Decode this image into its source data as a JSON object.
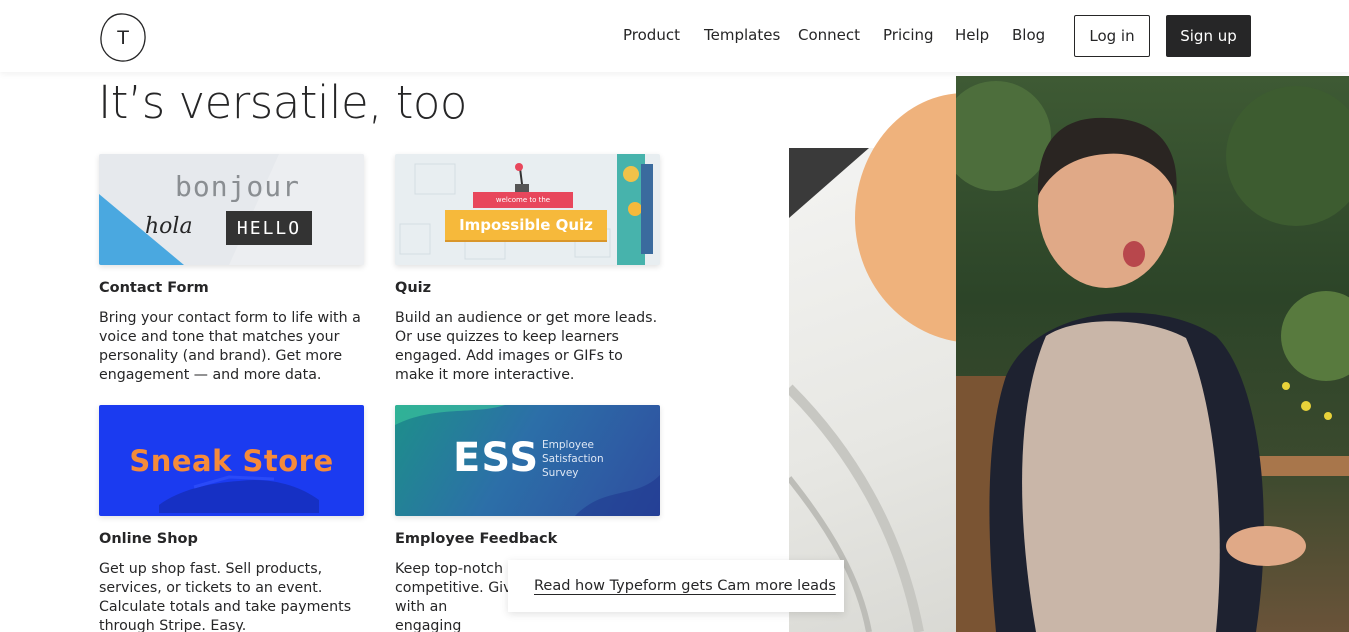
{
  "header": {
    "logo_letter": "T",
    "nav": [
      "Product",
      "Templates",
      "Connect",
      "Pricing",
      "Help",
      "Blog"
    ],
    "login_label": "Log in",
    "signup_label": "Sign up"
  },
  "main": {
    "heading": "It’s versatile, too",
    "cards": [
      {
        "title": "Contact Form",
        "description": "Bring your contact form to life with a voice and tone that matches your personality (and brand). Get more engagement — and more data.",
        "image_words": [
          "bonjour",
          "hola",
          "HELLO"
        ]
      },
      {
        "title": "Quiz",
        "description": "Build an audience or get more leads. Or use quizzes to keep learners engaged. Add images or GIFs to make it more interactive.",
        "image_words": [
          "welcome to the",
          "Impossible Quiz"
        ]
      },
      {
        "title": "Online Shop",
        "description": "Get up shop fast. Sell products, services, or tickets to an event. Calculate totals and take payments through Stripe. Easy.",
        "image_words": [
          "Sneak Store"
        ]
      },
      {
        "title": "Employee Feedback",
        "description": "Keep top-notch competitive. Giv with an engaging",
        "image_words": [
          "ESS",
          "Employee",
          "Satisfaction",
          "Survey"
        ]
      }
    ]
  },
  "cta": {
    "link_label": "Read how Typeform gets Cam more leads"
  },
  "colors": {
    "text": "#262627",
    "accent_orange": "#efb27c",
    "shop_blue": "#1b3bf0",
    "quiz_yellow": "#f6b93b"
  }
}
